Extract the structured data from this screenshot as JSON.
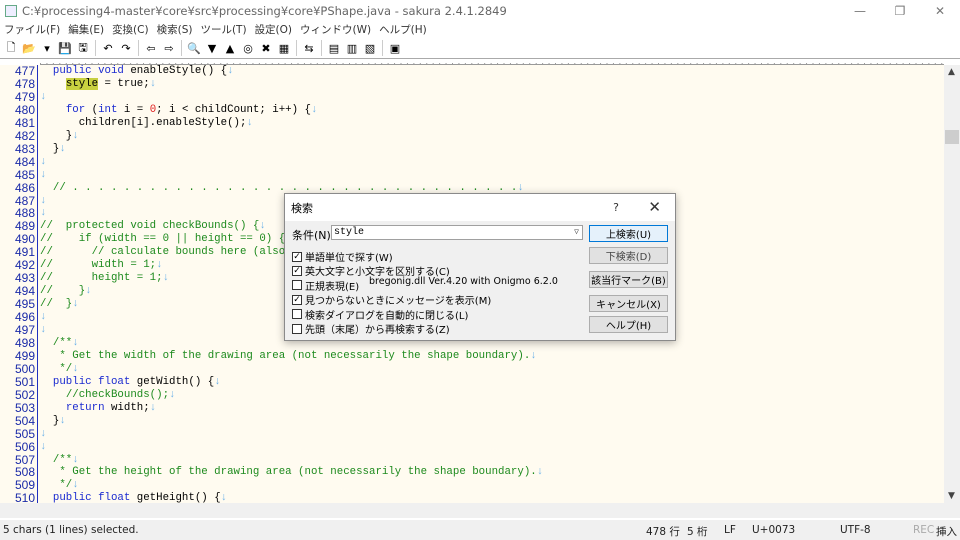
{
  "window": {
    "title": "C:¥processing4-master¥core¥src¥processing¥core¥PShape.java - sakura 2.4.1.2849",
    "minimize": "—",
    "restore": "❐",
    "close": "✕"
  },
  "menu": [
    "ファイル(F)",
    "編集(E)",
    "変換(C)",
    "検索(S)",
    "ツール(T)",
    "設定(O)",
    "ウィンドウ(W)",
    "ヘルプ(H)"
  ],
  "toolbar": [
    {
      "icon": "new-file-icon",
      "g": "🗋"
    },
    {
      "icon": "open-folder-icon",
      "g": "📂"
    },
    {
      "icon": "dropdown-icon",
      "g": "▾"
    },
    {
      "icon": "save-icon",
      "g": "💾"
    },
    {
      "icon": "save-all-icon",
      "g": "🖫"
    },
    "sep",
    {
      "icon": "undo-icon",
      "g": "↶"
    },
    {
      "icon": "redo-icon",
      "g": "↷"
    },
    "sep",
    {
      "icon": "jump-back-icon",
      "g": "⇦"
    },
    {
      "icon": "jump-forward-icon",
      "g": "⇨"
    },
    "sep",
    {
      "icon": "find-icon",
      "g": "🔍"
    },
    {
      "icon": "find-next-icon",
      "g": "▼"
    },
    {
      "icon": "find-prev-icon",
      "g": "▲"
    },
    {
      "icon": "find-mark-icon",
      "g": "◎"
    },
    {
      "icon": "clear-mark-icon",
      "g": "✖"
    },
    {
      "icon": "grep-icon",
      "g": "▦"
    },
    "sep",
    {
      "icon": "tag-jump-icon",
      "g": "⇆"
    },
    "sep",
    {
      "icon": "settings-icon",
      "g": "▤"
    },
    {
      "icon": "type-settings-icon",
      "g": "▥"
    },
    {
      "icon": "font-icon",
      "g": "▧"
    },
    "sep",
    {
      "icon": "outline-icon",
      "g": "▣"
    }
  ],
  "editor": {
    "lines": [
      {
        "n": "477",
        "t": [
          [
            "  ",
            "t"
          ],
          [
            "public void",
            "k"
          ],
          [
            " enableStyle() {",
            "t"
          ],
          [
            "↓",
            "m"
          ]
        ]
      },
      {
        "n": "478",
        "t": [
          [
            "    ",
            "t"
          ],
          [
            "style",
            "h"
          ],
          [
            " = true;",
            "t"
          ],
          [
            "↓",
            "m"
          ]
        ]
      },
      {
        "n": "479",
        "t": [
          [
            "↓",
            "m"
          ]
        ]
      },
      {
        "n": "480",
        "t": [
          [
            "    ",
            "t"
          ],
          [
            "for",
            "k"
          ],
          [
            " (",
            "t"
          ],
          [
            "int",
            "k"
          ],
          [
            " i = ",
            "t"
          ],
          [
            "0",
            "n"
          ],
          [
            "; i < childCount; i++) {",
            "t"
          ],
          [
            "↓",
            "m"
          ]
        ]
      },
      {
        "n": "481",
        "t": [
          [
            "      children[i].enableStyle();",
            "t"
          ],
          [
            "↓",
            "m"
          ]
        ]
      },
      {
        "n": "482",
        "t": [
          [
            "    }",
            "t"
          ],
          [
            "↓",
            "m"
          ]
        ]
      },
      {
        "n": "483",
        "t": [
          [
            "  }",
            "t"
          ],
          [
            "↓",
            "m"
          ]
        ]
      },
      {
        "n": "484",
        "t": [
          [
            "↓",
            "m"
          ]
        ]
      },
      {
        "n": "485",
        "t": [
          [
            "↓",
            "m"
          ]
        ]
      },
      {
        "n": "486",
        "t": [
          [
            "  // . . . . . . . . . . . . . . . . . . . . . . . . . . . . . . . . . . .",
            "c"
          ],
          [
            "↓",
            "m"
          ]
        ]
      },
      {
        "n": "487",
        "t": [
          [
            "↓",
            "m"
          ]
        ]
      },
      {
        "n": "488",
        "t": [
          [
            "↓",
            "m"
          ]
        ]
      },
      {
        "n": "489",
        "t": [
          [
            "//  protected void checkBounds() {",
            "c"
          ],
          [
            "↓",
            "m"
          ]
        ]
      },
      {
        "n": "490",
        "t": [
          [
            "//    if (width == 0 || height == 0) {",
            "c"
          ],
          [
            "↓",
            "m"
          ]
        ]
      },
      {
        "n": "491",
        "t": [
          [
            "//      // calculate bounds here (also take into account stroke width!)",
            "c"
          ],
          [
            "↓",
            "m"
          ]
        ]
      },
      {
        "n": "492",
        "t": [
          [
            "//      width = 1;",
            "c"
          ],
          [
            "↓",
            "m"
          ]
        ]
      },
      {
        "n": "493",
        "t": [
          [
            "//      height = 1;",
            "c"
          ],
          [
            "↓",
            "m"
          ]
        ]
      },
      {
        "n": "494",
        "t": [
          [
            "//    }",
            "c"
          ],
          [
            "↓",
            "m"
          ]
        ]
      },
      {
        "n": "495",
        "t": [
          [
            "//  }",
            "c"
          ],
          [
            "↓",
            "m"
          ]
        ]
      },
      {
        "n": "496",
        "t": [
          [
            "↓",
            "m"
          ]
        ]
      },
      {
        "n": "497",
        "t": [
          [
            "↓",
            "m"
          ]
        ]
      },
      {
        "n": "498",
        "t": [
          [
            "  /**",
            "c"
          ],
          [
            "↓",
            "m"
          ]
        ]
      },
      {
        "n": "499",
        "t": [
          [
            "   * Get the width of the drawing area (not necessarily the shape boundary).",
            "c"
          ],
          [
            "↓",
            "m"
          ]
        ]
      },
      {
        "n": "500",
        "t": [
          [
            "   */",
            "c"
          ],
          [
            "↓",
            "m"
          ]
        ]
      },
      {
        "n": "501",
        "t": [
          [
            "  ",
            "t"
          ],
          [
            "public float",
            "k"
          ],
          [
            " getWidth() {",
            "t"
          ],
          [
            "↓",
            "m"
          ]
        ]
      },
      {
        "n": "502",
        "t": [
          [
            "    ",
            "t"
          ],
          [
            "//checkBounds();",
            "c"
          ],
          [
            "↓",
            "m"
          ]
        ]
      },
      {
        "n": "503",
        "t": [
          [
            "    ",
            "t"
          ],
          [
            "return",
            "k"
          ],
          [
            " width;",
            "t"
          ],
          [
            "↓",
            "m"
          ]
        ]
      },
      {
        "n": "504",
        "t": [
          [
            "  }",
            "t"
          ],
          [
            "↓",
            "m"
          ]
        ]
      },
      {
        "n": "505",
        "t": [
          [
            "↓",
            "m"
          ]
        ]
      },
      {
        "n": "506",
        "t": [
          [
            "↓",
            "m"
          ]
        ]
      },
      {
        "n": "507",
        "t": [
          [
            "  /**",
            "c"
          ],
          [
            "↓",
            "m"
          ]
        ]
      },
      {
        "n": "508",
        "t": [
          [
            "   * Get the height of the drawing area (not necessarily the shape boundary).",
            "c"
          ],
          [
            "↓",
            "m"
          ]
        ]
      },
      {
        "n": "509",
        "t": [
          [
            "   */",
            "c"
          ],
          [
            "↓",
            "m"
          ]
        ]
      },
      {
        "n": "510",
        "t": [
          [
            "  ",
            "t"
          ],
          [
            "public float",
            "k"
          ],
          [
            " getHeight() {",
            "t"
          ],
          [
            "↓",
            "m"
          ]
        ]
      }
    ]
  },
  "dialog": {
    "title": "検索",
    "help": "?",
    "close": "✕",
    "cond_label": "条件(N)",
    "cond_value": "style",
    "options": [
      {
        "label": "単語単位で探す(W)",
        "checked": true
      },
      {
        "label": "英大文字と小文字を区別する(C)",
        "checked": true
      },
      {
        "label": "正規表現(E)",
        "checked": false
      },
      {
        "label": "見つからないときにメッセージを表示(M)",
        "checked": true
      },
      {
        "label": "検索ダイアログを自動的に閉じる(L)",
        "checked": false
      },
      {
        "label": "先頭（末尾）から再検索する(Z)",
        "checked": false
      }
    ],
    "regex_lib": "bregonig.dll Ver.4.20 with Onigmo 6.2.0",
    "buttons": {
      "up": "上検索(U)",
      "down": "下検索(D)",
      "mark": "該当行マーク(B)",
      "cancel": "キャンセル(X)",
      "help": "ヘルプ(H)"
    }
  },
  "status": {
    "selection": "5 chars (1 lines) selected.",
    "line": "478 行",
    "col": "5 桁",
    "eol": "LF",
    "code": "U+0073",
    "encoding": "UTF-8",
    "rec": "REC",
    "mode": "挿入"
  }
}
